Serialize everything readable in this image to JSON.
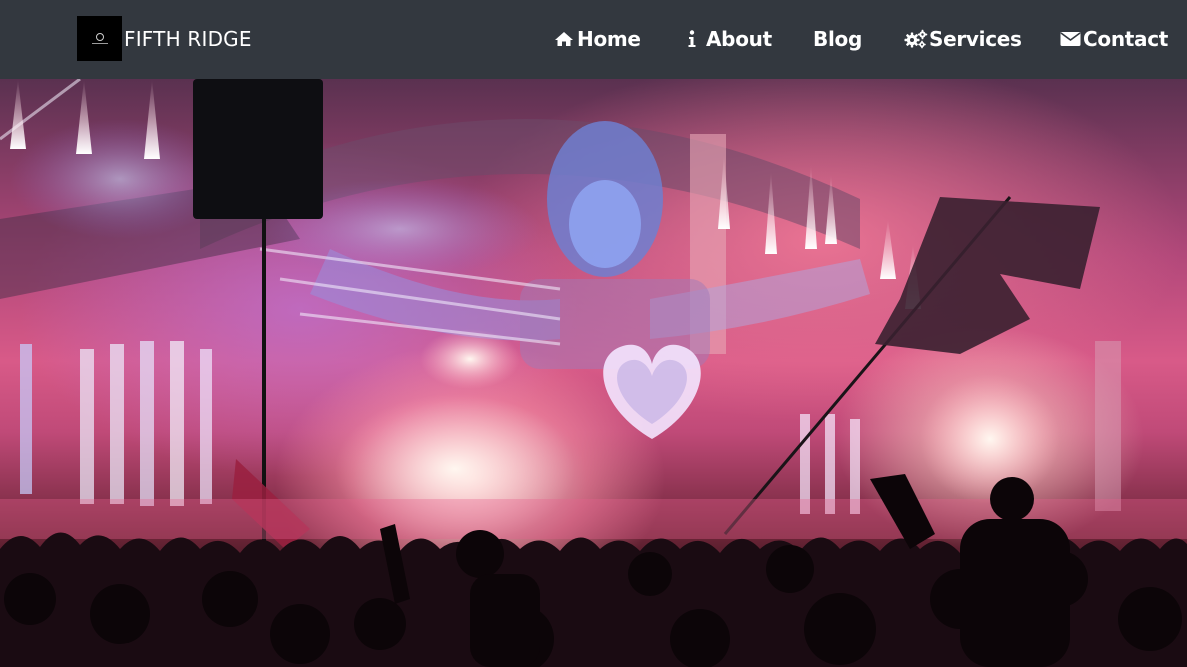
{
  "brand": {
    "name": "FIFTH RIDGE",
    "logo_icon": "ridge-logo"
  },
  "nav": {
    "items": [
      {
        "label": "Home",
        "icon": "home-icon"
      },
      {
        "label": "About",
        "icon": "info-icon"
      },
      {
        "label": "Blog",
        "icon": ""
      },
      {
        "label": "Services",
        "icon": "gears-icon"
      },
      {
        "label": "Contact",
        "icon": "envelope-icon"
      }
    ]
  },
  "colors": {
    "navbar_bg": "#33383f",
    "nav_text": "#ffffff"
  },
  "hero": {
    "image": "festival-stage-crowd-photo"
  }
}
